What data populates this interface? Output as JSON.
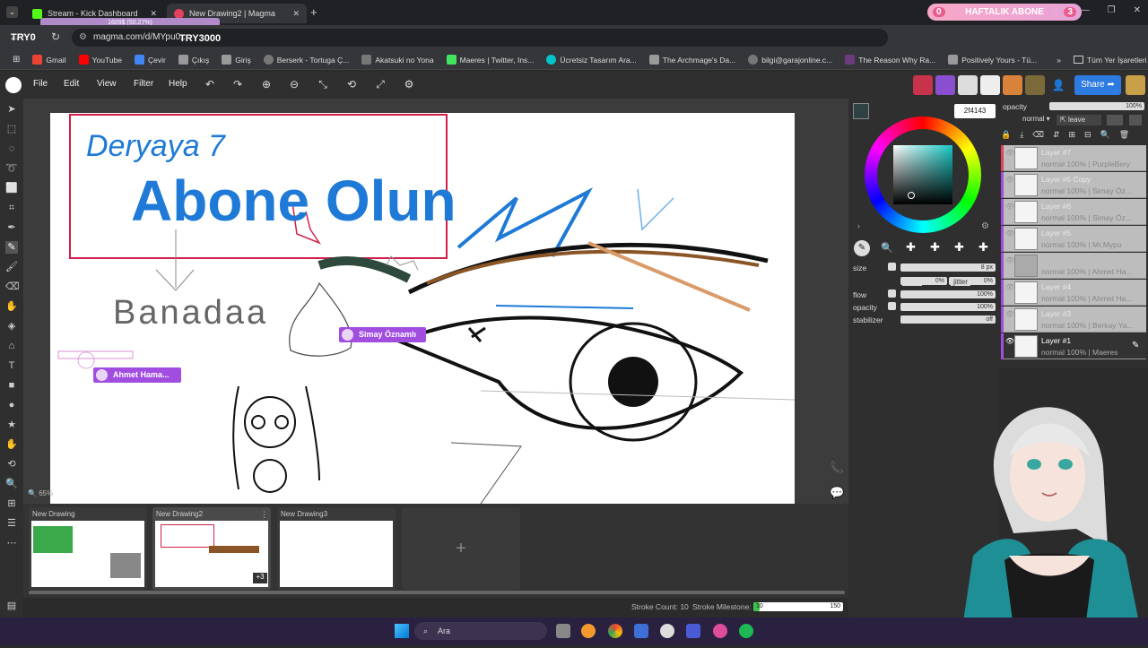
{
  "browser": {
    "tabs": [
      {
        "title": "Stream - Kick Dashboard",
        "active": false
      },
      {
        "title": "New Drawing2 | Magma",
        "active": true
      }
    ],
    "new_tab": "+",
    "url": "magma.com/d/MYpu0...",
    "bookmarks": [
      "Gmail",
      "YouTube",
      "Çevir",
      "Çıkış",
      "Giriş",
      "Berserk - Tortuga Ç...",
      "Akatsuki no Yona",
      "Maeres | Twitter, Ins...",
      "Ücretsiz Tasarım Ara...",
      "The Archmage's Da...",
      "bilgi@garajonline.c...",
      "The Reason Why Ra...",
      "Positively Yours - Tü..."
    ],
    "all_bookmarks": "Tüm Yer İşaretleri"
  },
  "overlay": {
    "weekly_label": "HAFTALIK ABONE",
    "weekly_left": "0",
    "weekly_right": "3",
    "try0": "TRY0",
    "try3000": "TRY3000",
    "progress_text": "1609$ (50.27%)"
  },
  "app": {
    "menu": [
      "File",
      "Edit",
      "View",
      "Filter",
      "Help"
    ],
    "share_label": "Share",
    "color_hex": "2f4143",
    "opacity_label": "opacity",
    "opacity_value": "100%",
    "blend_mode": "normal",
    "leave_label": "leave",
    "brush": {
      "size_label": "size",
      "size_value": "8 px",
      "min_label": "min",
      "min_value": "0%",
      "jitter_label": "jitter",
      "jitter_value": "0%",
      "flow_label": "flow",
      "flow_value": "100%",
      "opacity_label": "opacity",
      "opacity_value": "100%",
      "stabilizer_label": "stabilizer",
      "stabilizer_value": "off"
    },
    "zoom": "65%",
    "layers": [
      {
        "name": "Layer #7",
        "meta": "normal 100% | PurpleBery",
        "bar": "#e4405f"
      },
      {
        "name": "Layer #6 Copy",
        "meta": "normal 100% | Simay Öz...",
        "bar": "#a14ee0"
      },
      {
        "name": "Layer #6",
        "meta": "normal 100% | Simay Öz...",
        "bar": "#a14ee0"
      },
      {
        "name": "Layer #5",
        "meta": "normal 100% | Mr.Mypo",
        "bar": "#a14ee0"
      },
      {
        "name": "",
        "meta": "normal 100% | Ahmet Ha...",
        "bar": "#a14ee0"
      },
      {
        "name": "Layer #4",
        "meta": "normal 100% | Ahmet Ha...",
        "bar": "#a14ee0"
      },
      {
        "name": "Layer #3",
        "meta": "normal 100% | Berkay Ya...",
        "bar": "#a14ee0"
      },
      {
        "name": "Layer #1",
        "meta": "normal 100% | Maeres",
        "bar": "#a14ee0",
        "active": true
      }
    ],
    "drawings": [
      {
        "title": "New Drawing"
      },
      {
        "title": "New Drawing2",
        "badge": "+3"
      },
      {
        "title": "New Drawing3"
      }
    ],
    "add_drawing": "+",
    "stroke_count_label": "Stroke Count: 10",
    "stroke_milestone_label": "Stroke Milestone:",
    "stroke_milestone_value": "10",
    "stroke_milestone_max": "150",
    "stroke_progress": 0.07
  },
  "canvas": {
    "text_top": "Deryaya 7",
    "text_main": "Abone Olun",
    "text_side": "Banadaa",
    "cursors": [
      {
        "name": "Simay Öznamlı"
      },
      {
        "name": "Ahmet Hama..."
      }
    ]
  },
  "taskbar": {
    "search_placeholder": "Ara"
  },
  "colors": {
    "accent": "#2d7ae0",
    "cursor_purple": "#a14ee0",
    "current_color": "#2f4143"
  }
}
